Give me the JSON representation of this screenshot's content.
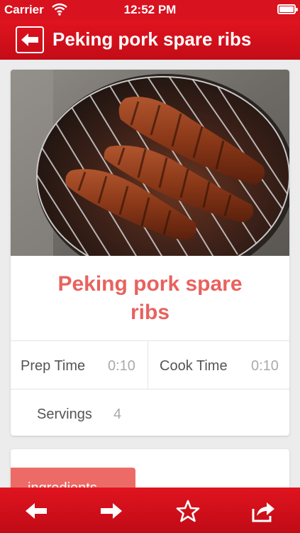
{
  "status_bar": {
    "carrier": "Carrier",
    "time": "12:52 PM"
  },
  "nav": {
    "title": "Peking pork spare ribs",
    "back_icon": "back-arrow-icon"
  },
  "recipe": {
    "title": "Peking pork spare ribs",
    "prep_time_label": "Prep Time",
    "prep_time_value": "0:10",
    "cook_time_label": "Cook Time",
    "cook_time_value": "0:10",
    "servings_label": "Servings",
    "servings_value": "4"
  },
  "ingredients": {
    "tab_label": "ingredients"
  },
  "toolbar": {
    "items": [
      "arrow-left-icon",
      "arrow-right-icon",
      "star-icon",
      "share-icon"
    ]
  },
  "colors": {
    "brand_red": "#d8121f",
    "title_coral": "#e8625e",
    "tab_coral": "#ec6b66"
  }
}
